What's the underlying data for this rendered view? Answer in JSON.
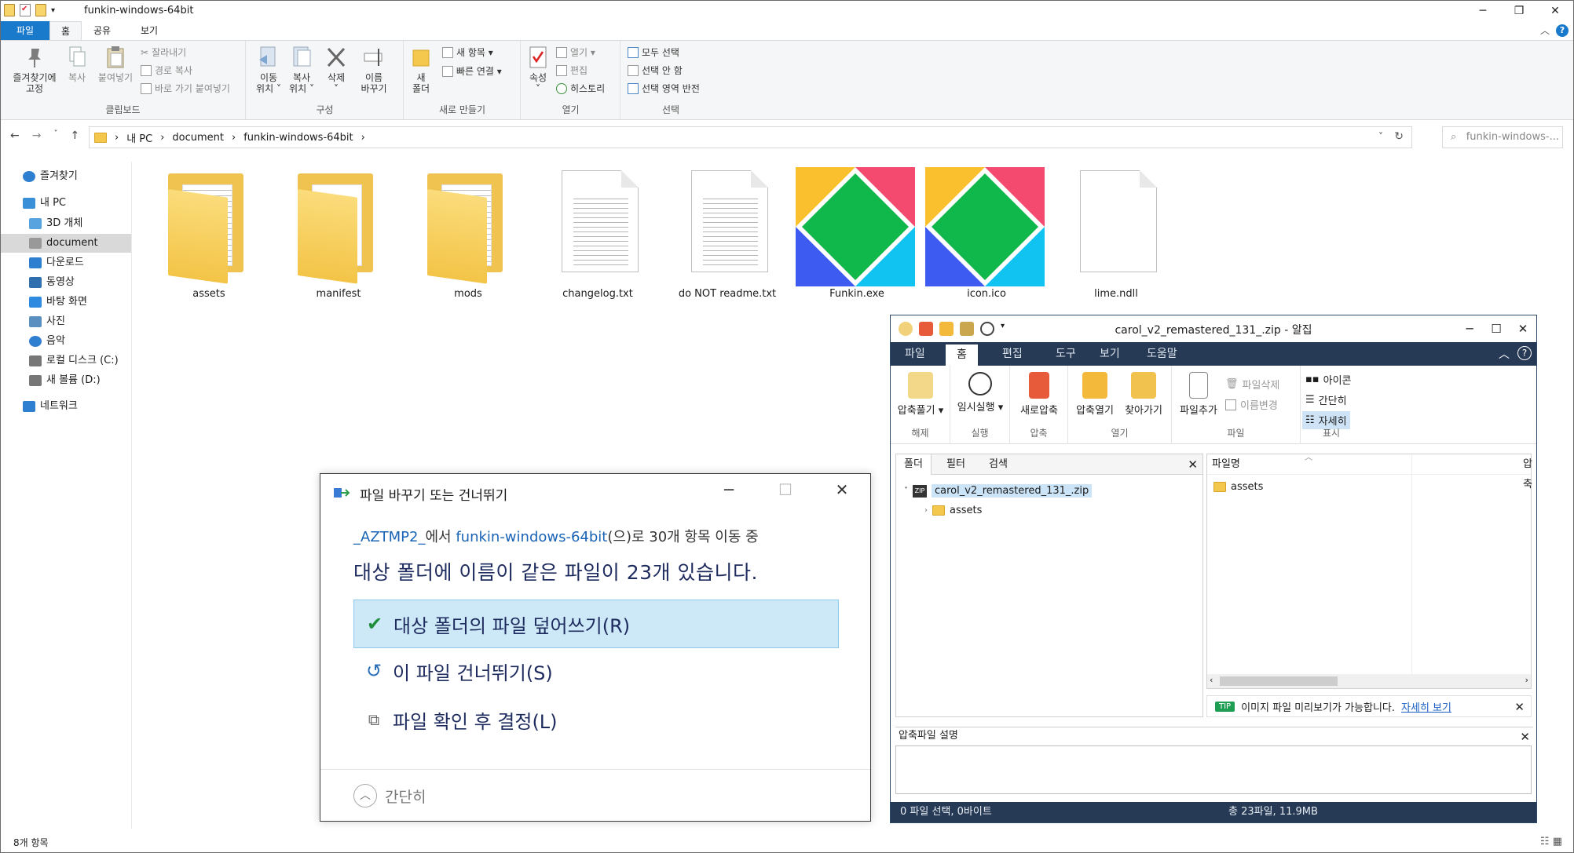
{
  "explorer": {
    "title": "funkin-windows-64bit",
    "tabs": [
      "파일",
      "홈",
      "공유",
      "보기"
    ],
    "ribbon": {
      "clipboard": {
        "label": "클립보드",
        "pin": "즐겨찾기에\n고정",
        "copy": "복사",
        "paste": "붙여넣기",
        "cut": "잘라내기",
        "copy_path": "경로 복사",
        "paste_shortcut": "바로 가기 붙여넣기"
      },
      "organize": {
        "label": "구성",
        "move_to": "이동\n위치 ˅",
        "copy_to": "복사\n위치 ˅",
        "delete": "삭제\n˅",
        "rename": "이름\n바꾸기"
      },
      "new": {
        "label": "새로 만들기",
        "new_folder": "새\n폴더",
        "new_item": "새 항목 ▾",
        "quick_access": "빠른 연결 ▾"
      },
      "open": {
        "label": "열기",
        "properties": "속성\n˅",
        "open": "열기 ▾",
        "edit": "편집",
        "history": "히스토리"
      },
      "select": {
        "label": "선택",
        "select_all": "모두 선택",
        "select_none": "선택 안 함",
        "invert": "선택 영역 반전"
      }
    },
    "breadcrumb": [
      "내 PC",
      "document",
      "funkin-windows-64bit"
    ],
    "search_placeholder": "funkin-windows-...",
    "sidebar": [
      {
        "label": "즐겨찾기",
        "icon": "star-icon",
        "indent": 1
      },
      {
        "label": "내 PC",
        "icon": "pc-icon",
        "indent": 1
      },
      {
        "label": "3D 개체",
        "icon": "cube-icon",
        "indent": 2
      },
      {
        "label": "document",
        "icon": "document-icon",
        "indent": 2,
        "selected": true
      },
      {
        "label": "다운로드",
        "icon": "download-icon",
        "indent": 2
      },
      {
        "label": "동영상",
        "icon": "video-icon",
        "indent": 2
      },
      {
        "label": "바탕 화면",
        "icon": "desktop-icon",
        "indent": 2
      },
      {
        "label": "사진",
        "icon": "picture-icon",
        "indent": 2
      },
      {
        "label": "음악",
        "icon": "music-icon",
        "indent": 2
      },
      {
        "label": "로컬 디스크 (C:)",
        "icon": "drive-icon",
        "indent": 2
      },
      {
        "label": "새 볼륨 (D:)",
        "icon": "drive-icon",
        "indent": 2
      },
      {
        "label": "네트워크",
        "icon": "network-icon",
        "indent": 1
      }
    ],
    "files": [
      {
        "name": "assets",
        "kind": "folder-docs"
      },
      {
        "name": "manifest",
        "kind": "folder-paper"
      },
      {
        "name": "mods",
        "kind": "folder-docs"
      },
      {
        "name": "changelog.txt",
        "kind": "text"
      },
      {
        "name": "do NOT readme.txt",
        "kind": "text"
      },
      {
        "name": "Funkin.exe",
        "kind": "haxe"
      },
      {
        "name": "icon.ico",
        "kind": "haxe"
      },
      {
        "name": "lime.ndll",
        "kind": "blank"
      }
    ],
    "status": "8개 항목"
  },
  "dialog": {
    "title": "파일 바꾸기 또는 건너뛰기",
    "from_source": "_AZTMP2_",
    "from_mid": "에서 ",
    "from_dest": "funkin-windows-64bit",
    "from_tail": "(으)로 30개 항목 이동 중",
    "heading": "대상 폴더에 이름이 같은 파일이 23개 있습니다.",
    "option_replace": "대상 폴더의 파일 덮어쓰기(R)",
    "option_skip": "이 파일 건너뛰기(S)",
    "option_decide": "파일 확인 후 결정(L)",
    "fewer_details": "간단히"
  },
  "alzip": {
    "title": "carol_v2_remastered_131_.zip - 알집",
    "tabs": [
      "파일",
      "홈",
      "편집",
      "도구",
      "보기",
      "도움말"
    ],
    "ribbon": {
      "extract": "압축풀기 ▾",
      "extract_group": "해제",
      "run": "임시실행 ▾",
      "run_group": "실행",
      "new_zip": "새로압축",
      "zip_group": "압축",
      "open_zip": "압축열기",
      "find": "찾아가기",
      "open_group": "열기",
      "add_file": "파일추가",
      "delete_file": "파일삭제",
      "rename": "이름변경",
      "file_group": "파일",
      "view_icon": "아이콘",
      "view_simple": "간단히",
      "view_detail": "자세히",
      "view_group": "표시"
    },
    "left_tabs": [
      "폴더",
      "필터",
      "검색"
    ],
    "tree_root": "carol_v2_remastered_131_.zip",
    "tree_child": "assets",
    "col_filename": "파일명",
    "col_compress": "압축",
    "list": [
      "assets"
    ],
    "tip_tag": "TIP",
    "tip_text": "이미지 파일 미리보기가 가능합니다.",
    "tip_link": "자세히 보기",
    "desc_label": "압축파일 설명",
    "status_left": "0 파일 선택,  0바이트",
    "status_right": "총 23파일,  11.9MB"
  }
}
